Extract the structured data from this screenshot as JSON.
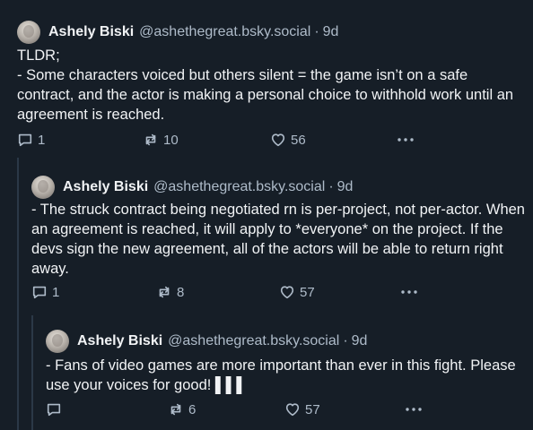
{
  "posts": [
    {
      "author": "Ashely Biski",
      "handle": "@ashethegreat.bsky.social",
      "sep": "·",
      "time": "9d",
      "text": "TLDR;\n- Some characters voiced but others silent = the game isn’t on a safe contract, and the actor is making a personal choice to withhold work until an agreement is reached.",
      "replies": "1",
      "reposts": "10",
      "likes": "56"
    },
    {
      "author": "Ashely Biski",
      "handle": "@ashethegreat.bsky.social",
      "sep": "·",
      "time": "9d",
      "text": "- The struck contract being negotiated rn is per-project, not per-actor. When an agreement is reached, it will apply to *everyone* on the project. If the devs sign the new agreement, all of the actors will be able to return right away.",
      "replies": "1",
      "reposts": "8",
      "likes": "57"
    },
    {
      "author": "Ashely Biski",
      "handle": "@ashethegreat.bsky.social",
      "sep": "·",
      "time": "9d",
      "text": "- Fans of video games are more important than ever in this fight. Please use your voices for good! ▌▌▌",
      "replies": "",
      "reposts": "6",
      "likes": "57"
    }
  ],
  "icons": {
    "reply": "speech-bubble-icon",
    "repost": "repost-arrows-icon",
    "like": "heart-icon",
    "more": "ellipsis-icon"
  }
}
